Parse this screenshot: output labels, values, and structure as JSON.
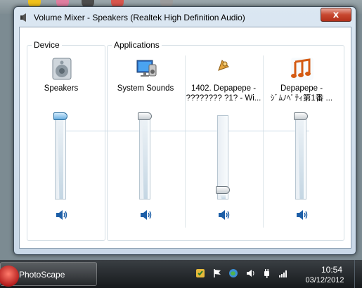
{
  "window": {
    "title": "Volume Mixer - Speakers (Realtek High Definition Audio)",
    "close_glyph": "x"
  },
  "device_group": {
    "label": "Device",
    "channels": [
      {
        "label": "Speakers",
        "icon": "speaker-device-icon",
        "volume_percent": 100
      }
    ]
  },
  "apps_group": {
    "label": "Applications",
    "channels": [
      {
        "label": "System Sounds",
        "icon": "system-sounds-icon",
        "volume_percent": 100
      },
      {
        "label_line1": "1402. Depapepe -",
        "label_line2": "???????? ?1?  - Wi...",
        "icon": "media-app-icon",
        "volume_percent": 5
      },
      {
        "label_line1": "Depapepe -",
        "label_line2": "ｼﾞﾑﾉﾍﾟﾃｨ第1番  ...",
        "icon": "music-notes-icon",
        "volume_percent": 100
      }
    ]
  },
  "taskbar": {
    "task_label": "PhotoScape",
    "clock_time": "10:54",
    "clock_date": "03/12/2012"
  },
  "colors": {
    "accent": "#2b6e9e",
    "close_button": "#c7472f",
    "taskbar": "#16191c"
  }
}
